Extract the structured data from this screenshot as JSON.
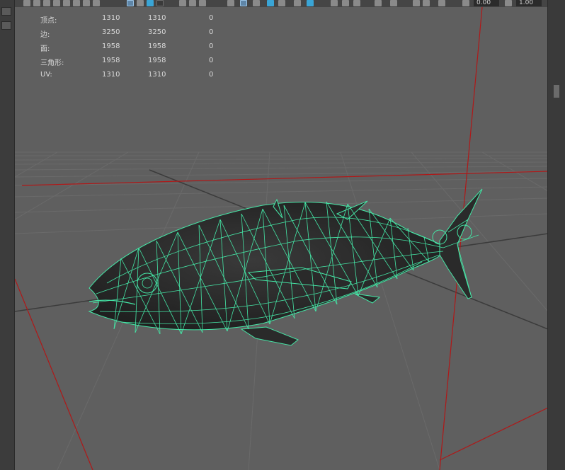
{
  "toolbar": {
    "field_a": "0.00",
    "field_b": "1.00",
    "icons": [
      "poly-icon",
      "cube-icon",
      "sphere-icon",
      "shaded-icon",
      "textured-icon",
      "light-icon",
      "shadow-icon",
      "grid-icon",
      "xray-icon",
      "isolate-icon",
      "camera-icon",
      "resolution-icon",
      "gate-icon",
      "safe-area-icon",
      "film-icon",
      "smooth-icon",
      "wireframe-icon"
    ]
  },
  "hud": {
    "rows": [
      {
        "label": "顶点:",
        "v1": "1310",
        "v2": "1310",
        "v3": "0"
      },
      {
        "label": "边:",
        "v1": "3250",
        "v2": "3250",
        "v3": "0"
      },
      {
        "label": "面:",
        "v1": "1958",
        "v2": "1958",
        "v3": "0"
      },
      {
        "label": "三角形:",
        "v1": "1958",
        "v2": "1958",
        "v3": "0"
      },
      {
        "label": "UV:",
        "v1": "1310",
        "v2": "1310",
        "v3": "0"
      }
    ]
  },
  "colors": {
    "viewport_bg": "#5f5f5f",
    "grid": "#6c6c6c",
    "grid_axis": "#3a3a3a",
    "wireframe": "#45e6a6",
    "fish_fill": "#2e2e2e",
    "red_line": "#b01818"
  }
}
